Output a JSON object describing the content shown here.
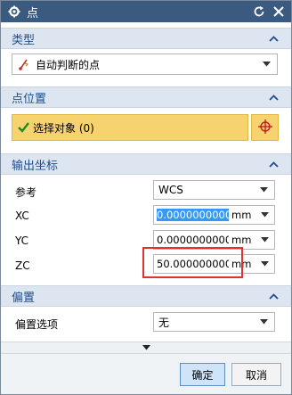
{
  "window": {
    "title": "点"
  },
  "sections": {
    "type": {
      "label": "类型",
      "dropdown_value": "自动判断的点"
    },
    "point_location": {
      "label": "点位置",
      "select_object_label": "选择对象 (0)"
    },
    "output_coordinates": {
      "label": "输出坐标",
      "reference": {
        "label": "参考",
        "value": "WCS"
      },
      "xc": {
        "label": "XC",
        "value": "0.0000000000",
        "unit": "mm"
      },
      "yc": {
        "label": "YC",
        "value": "0.0000000000",
        "unit": "mm"
      },
      "zc": {
        "label": "ZC",
        "value": "50.000000000",
        "unit": "mm"
      }
    },
    "offset": {
      "label": "偏置",
      "option_label": "偏置选项",
      "option_value": "无"
    }
  },
  "buttons": {
    "ok": "确定",
    "cancel": "取消"
  },
  "colors": {
    "title_bar": "#3a5a80",
    "section_text": "#1f4d8f",
    "selection_bar": "#f6d36e",
    "highlight": "#e03030"
  }
}
